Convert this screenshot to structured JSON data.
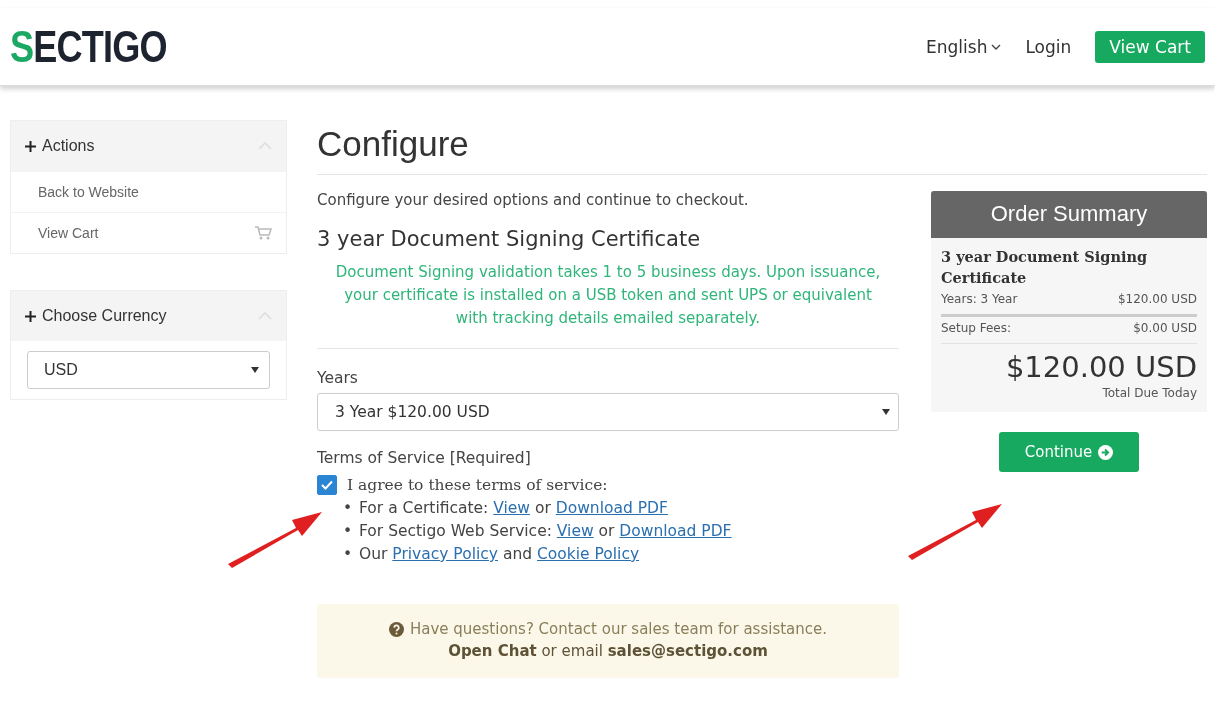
{
  "header": {
    "logo_mark": "S",
    "logo_word": "ECTIGO",
    "language": "English",
    "login": "Login",
    "cart_button": "View Cart"
  },
  "sidebar": {
    "panels": [
      {
        "title": "Actions",
        "expanded": true,
        "items": [
          {
            "label": "Back to Website",
            "kind": "link"
          },
          {
            "label": "View Cart",
            "kind": "cart"
          }
        ]
      },
      {
        "title": "Choose Currency",
        "expanded": true,
        "select": "USD"
      }
    ]
  },
  "main": {
    "title": "Configure",
    "intro": "Configure your desired options and continue to checkout.",
    "product": "3 year Document Signing Certificate",
    "notice": "Document Signing validation takes 1 to 5 business days. Upon issuance, your certificate is installed on a USB token and sent UPS or equivalent with tracking details emailed separately.",
    "years_label": "Years",
    "years_value": "3 Year $120.00 USD",
    "tos_label": "Terms of Service [Required]",
    "agree": {
      "label": "I agree to these terms of service:",
      "checked": true
    },
    "tos_items": [
      {
        "bullet": "•",
        "parts": [
          {
            "kind": "text",
            "text": "For a Certificate: "
          },
          {
            "kind": "link",
            "text": "View"
          },
          {
            "kind": "text",
            "text": " or "
          },
          {
            "kind": "link",
            "text": "Download PDF"
          }
        ]
      },
      {
        "bullet": "•",
        "parts": [
          {
            "kind": "text",
            "text": "For Sectigo Web Service: "
          },
          {
            "kind": "link",
            "text": "View"
          },
          {
            "kind": "text",
            "text": " or "
          },
          {
            "kind": "link",
            "text": "Download PDF"
          }
        ]
      },
      {
        "bullet": "•",
        "parts": [
          {
            "kind": "text",
            "text": "Our "
          },
          {
            "kind": "link",
            "text": "Privacy Policy"
          },
          {
            "kind": "text",
            "text": " and "
          },
          {
            "kind": "link",
            "text": "Cookie Policy"
          }
        ]
      }
    ],
    "help_line": "Have questions? Contact our sales team for assistance.",
    "help_contact": "**Open Chat** or email **sales@sectigo.com**"
  },
  "summary": {
    "title": "Order Summary",
    "product": "3 year Document Signing Certificate",
    "rows": [
      {
        "label": "Years: 3 Year",
        "value": "$120.00 USD"
      },
      {
        "label": "Setup Fees:",
        "value": "$0.00 USD"
      }
    ],
    "total": "$120.00 USD",
    "total_label": "Total Due Today",
    "button": "Continue"
  }
}
